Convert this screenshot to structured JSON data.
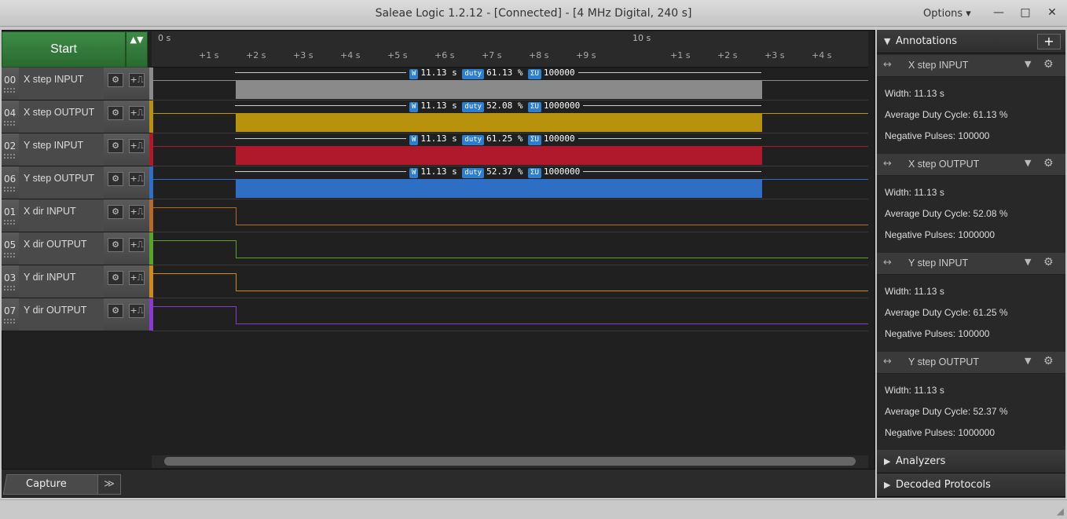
{
  "window": {
    "title": "Saleae Logic 1.2.12 - [Connected] - [4 MHz Digital, 240 s]",
    "options_label": "Options ▾",
    "minimize": "—",
    "maximize": "□",
    "close": "✕"
  },
  "toolbar": {
    "start_label": "Start",
    "arrows": "▲▼"
  },
  "ruler": {
    "major_left": "0 s",
    "major_right": "10 s",
    "ticks": [
      "+1 s",
      "+2 s",
      "+3 s",
      "+4 s",
      "+5 s",
      "+6 s",
      "+7 s",
      "+8 s",
      "+9 s",
      "+1 s",
      "+2 s",
      "+3 s",
      "+4 s"
    ]
  },
  "channels": [
    {
      "num": "00",
      "name": "X step INPUT",
      "color": "#8a8a8a",
      "type": "step",
      "width": "11.13 s",
      "duty": "61.13 %",
      "count": "100000"
    },
    {
      "num": "04",
      "name": "X step OUTPUT",
      "color": "#b8920c",
      "type": "step",
      "width": "11.13 s",
      "duty": "52.08 %",
      "count": "1000000"
    },
    {
      "num": "02",
      "name": "Y step INPUT",
      "color": "#b0192b",
      "type": "step",
      "width": "11.13 s",
      "duty": "61.25 %",
      "count": "100000"
    },
    {
      "num": "06",
      "name": "Y step OUTPUT",
      "color": "#2f6ec5",
      "type": "step",
      "width": "11.13 s",
      "duty": "52.37 %",
      "count": "1000000"
    },
    {
      "num": "01",
      "name": "X dir INPUT",
      "color": "#b56a2a",
      "type": "dir"
    },
    {
      "num": "05",
      "name": "X dir OUTPUT",
      "color": "#5aa32a",
      "type": "dir"
    },
    {
      "num": "03",
      "name": "Y dir INPUT",
      "color": "#d08a1a",
      "type": "dir"
    },
    {
      "num": "07",
      "name": "Y dir OUTPUT",
      "color": "#8a3ad0",
      "type": "dir"
    }
  ],
  "badges": {
    "width": "W",
    "duty": "duty",
    "count": "ΣU"
  },
  "bottom": {
    "capture_label": "Capture",
    "expand": "≫"
  },
  "annotations_panel": {
    "title": "Annotations",
    "add": "+",
    "items": [
      {
        "label": "X step INPUT",
        "width": "Width: 11.13 s",
        "duty": "Average Duty Cycle: 61.13 %",
        "neg": "Negative Pulses: 100000"
      },
      {
        "label": "X step OUTPUT",
        "width": "Width: 11.13 s",
        "duty": "Average Duty Cycle: 52.08 %",
        "neg": "Negative Pulses: 1000000"
      },
      {
        "label": "Y step INPUT",
        "width": "Width: 11.13 s",
        "duty": "Average Duty Cycle: 61.25 %",
        "neg": "Negative Pulses: 100000"
      },
      {
        "label": "Y step OUTPUT",
        "width": "Width: 11.13 s",
        "duty": "Average Duty Cycle: 52.37 %",
        "neg": "Negative Pulses: 1000000"
      }
    ]
  },
  "analyzers_label": "Analyzers",
  "decoded_label": "Decoded Protocols"
}
